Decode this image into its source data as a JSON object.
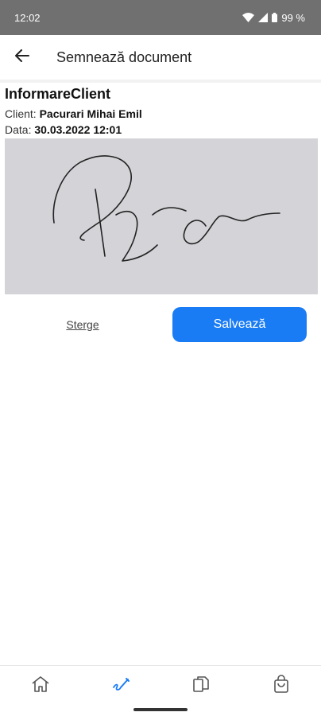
{
  "status_bar": {
    "time": "12:02",
    "battery": "99 %",
    "icons": [
      "wifi-icon",
      "signal-icon",
      "battery-icon"
    ]
  },
  "app_bar": {
    "title": "Semnează document",
    "back_icon": "arrow-back-icon"
  },
  "document": {
    "title": "InformareClient",
    "client_label": "Client:",
    "client_value": "Pacurari Mihai Emil",
    "date_label": "Data:",
    "date_value": "30.03.2022 12:01"
  },
  "signature_pad": {
    "background": "#d3d3d8",
    "ink_color": "#222222"
  },
  "actions": {
    "clear_label": "Sterge",
    "save_label": "Salvează"
  },
  "bottom_nav": {
    "items": [
      {
        "icon": "home-icon",
        "active": false
      },
      {
        "icon": "signature-icon",
        "active": true
      },
      {
        "icon": "documents-icon",
        "active": false
      },
      {
        "icon": "shopping-bag-icon",
        "active": false
      }
    ]
  },
  "colors": {
    "accent": "#1a7cf5",
    "status_bar": "#707070"
  }
}
